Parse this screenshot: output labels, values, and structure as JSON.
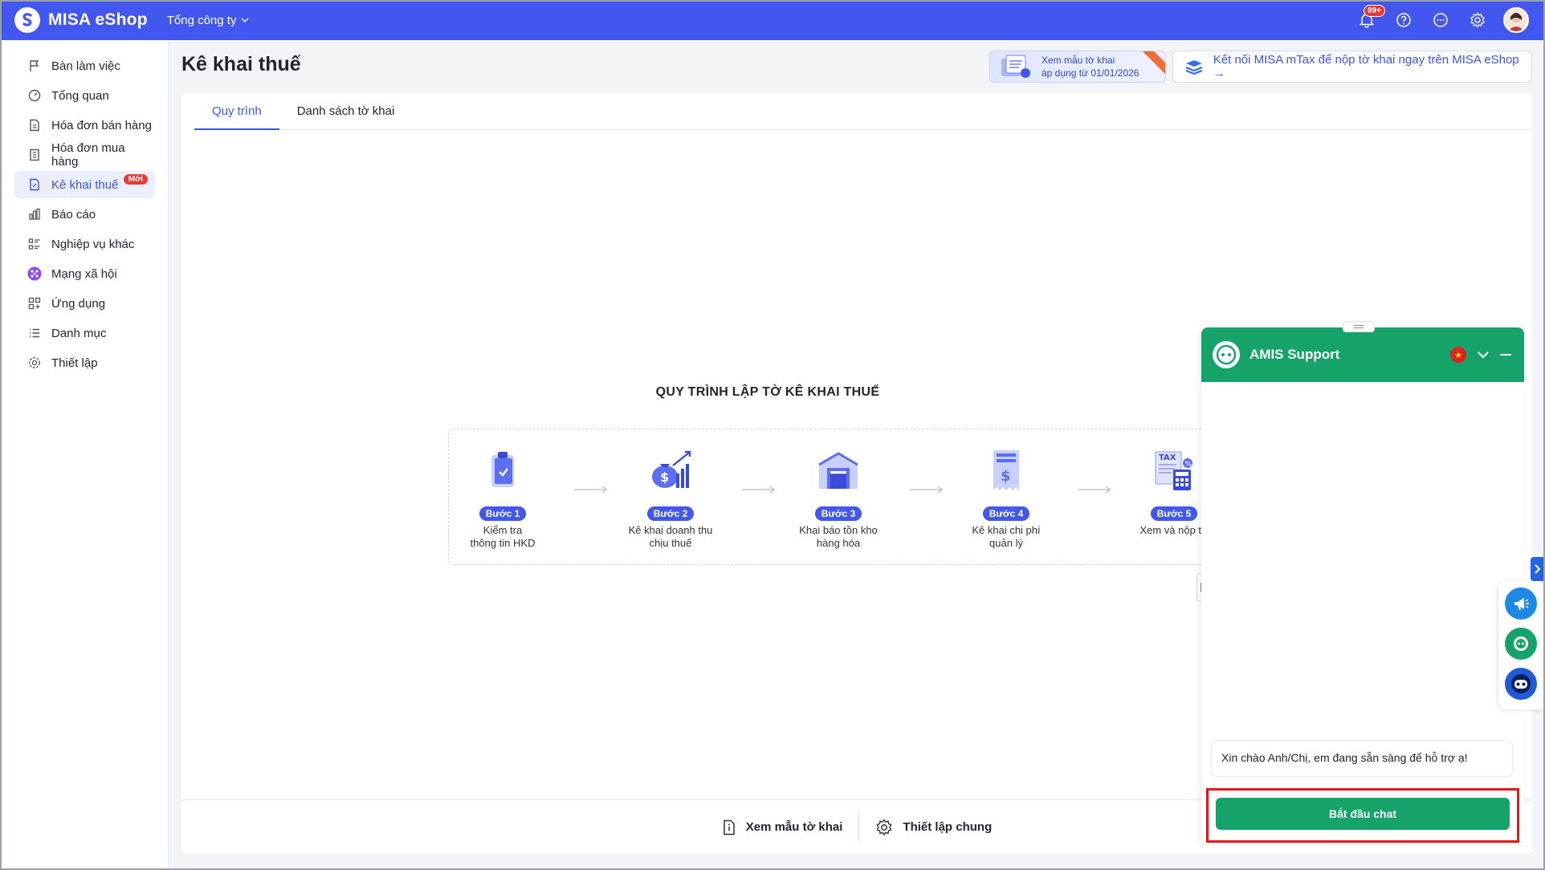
{
  "app": {
    "name": "MISA eShop",
    "company": "Tổng công ty",
    "notification_count": "99+"
  },
  "sidebar": {
    "items": [
      {
        "label": "Bàn làm việc",
        "icon": "flag-icon"
      },
      {
        "label": "Tổng quan",
        "icon": "dashboard-icon"
      },
      {
        "label": "Hóa đơn bán hàng",
        "icon": "invoice-icon"
      },
      {
        "label": "Hóa đơn mua hàng",
        "icon": "receipt-icon"
      },
      {
        "label": "Kê khai thuế",
        "icon": "tax-form-icon",
        "badge": "Mới",
        "active": true
      },
      {
        "label": "Báo cáo",
        "icon": "chart-icon"
      },
      {
        "label": "Nghiệp vụ khác",
        "icon": "list-icon"
      },
      {
        "label": "Mạng xã hội",
        "icon": "social-icon"
      },
      {
        "label": "Ứng dụng",
        "icon": "apps-icon"
      },
      {
        "label": "Danh mục",
        "icon": "menu-list-icon"
      },
      {
        "label": "Thiết lập",
        "icon": "gear-icon"
      }
    ]
  },
  "page": {
    "title": "Kê khai thuế",
    "promo_sample": {
      "line1": "Xem mẫu tờ khai",
      "line2": "áp dụng từ 01/01/2026"
    },
    "promo_connect": "Kết nối MISA mTax để nộp tờ khai ngay trên MISA eShop →",
    "tabs": [
      "Quy trình",
      "Danh sách tờ khai"
    ],
    "active_tab": 0
  },
  "flow": {
    "title": "QUY TRÌNH LẬP TỜ KÊ KHAI THUẾ",
    "steps": [
      {
        "badge": "Bước 1",
        "line1": "Kiểm tra",
        "line2": "thông tin HKD",
        "icon": "clipboard-check-icon"
      },
      {
        "badge": "Bước 2",
        "line1": "Kê khai doanh thu",
        "line2": "chịu thuế",
        "icon": "revenue-growth-icon"
      },
      {
        "badge": "Bước 3",
        "line1": "Khai báo tồn kho",
        "line2": "hàng hóa",
        "icon": "warehouse-icon"
      },
      {
        "badge": "Bước 4",
        "line1": "Kê khai chi phí",
        "line2": "quản lý",
        "icon": "expense-receipt-icon"
      },
      {
        "badge": "Bước 5",
        "line1": "Xem và nộp tờ",
        "line2": "",
        "icon": "tax-calculator-icon",
        "tax_label": "TAX"
      }
    ]
  },
  "footer": {
    "view_sample": "Xem mẫu tờ khai",
    "general_settings": "Thiết lập chung"
  },
  "chat": {
    "title": "AMIS Support",
    "greeting": "Xin chào Anh/Chị, em đang sẵn sàng để hỗ trợ ạ!",
    "start_button": "Bắt đầu chat",
    "header_color": "#16a36a"
  },
  "colors": {
    "primary": "#4256f0",
    "accent_red": "#e53935",
    "chat_green": "#16a36a"
  }
}
